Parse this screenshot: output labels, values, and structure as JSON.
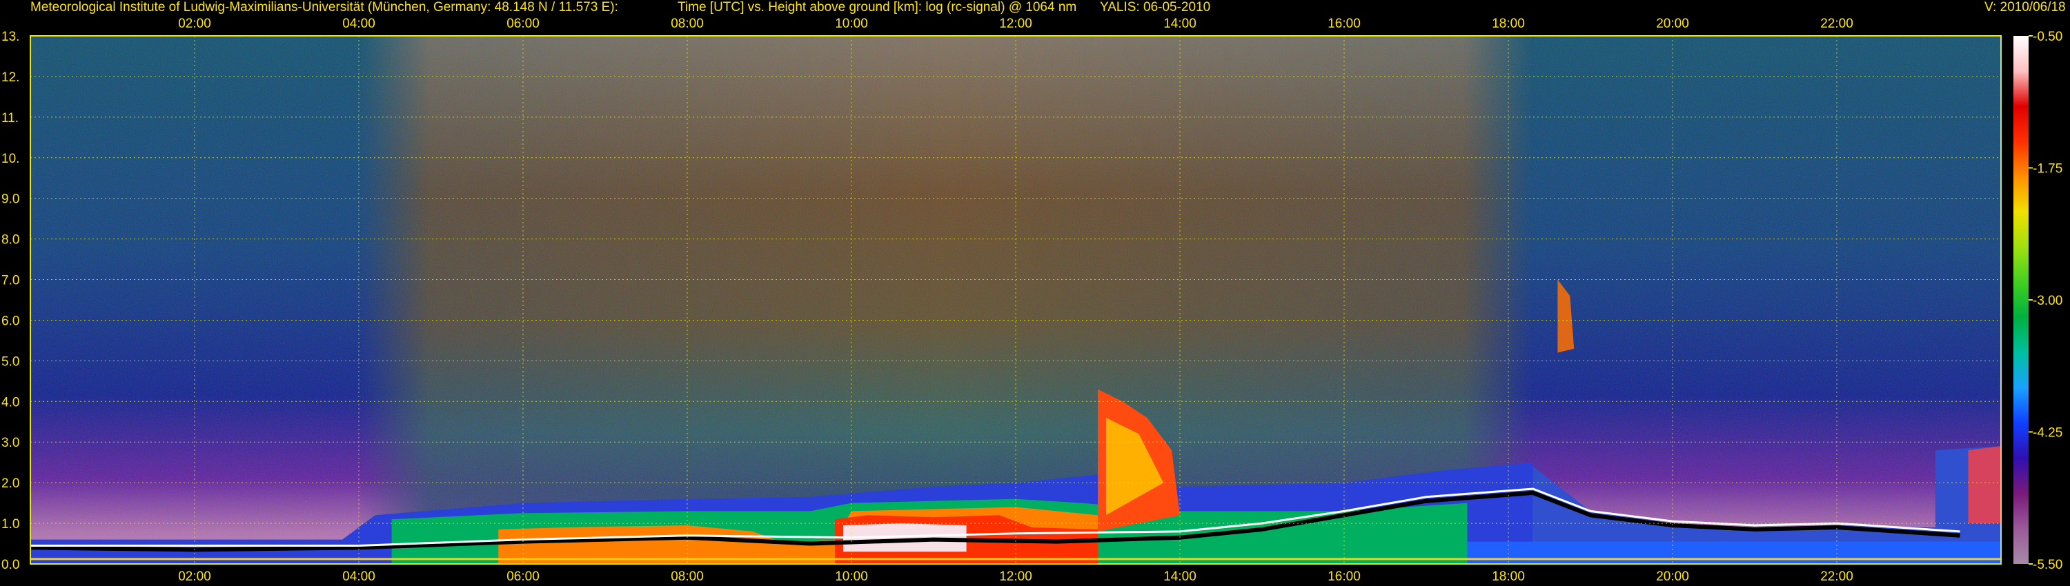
{
  "header": {
    "institute": "Meteorological Institute of Ludwig-Maximilians-Universität (München, Germany: 48.148 N / 11.573 E):",
    "title": "Time [UTC] vs. Height above ground [km]: log (rc-signal) @ 1064 nm",
    "instrument": "YALIS: 06-05-2010",
    "version": "V: 2010/06/18"
  },
  "chart_data": {
    "type": "heatmap",
    "title": "Time [UTC] vs. Height above ground [km]: log (rc-signal) @ 1064 nm",
    "x_ticks": [
      "02:00",
      "04:00",
      "06:00",
      "08:00",
      "10:00",
      "12:00",
      "14:00",
      "16:00",
      "18:00",
      "20:00",
      "22:00"
    ],
    "x_range_hours": [
      0,
      24
    ],
    "x_tick_hours": [
      2,
      4,
      6,
      8,
      10,
      12,
      14,
      16,
      18,
      20,
      22
    ],
    "y_ticks": [
      "0.0",
      "1.0",
      "2.0",
      "3.0",
      "4.0",
      "5.0",
      "6.0",
      "7.0",
      "8.0",
      "9.0",
      "10.",
      "11.",
      "12.",
      "13."
    ],
    "y_range_km": [
      0,
      13
    ],
    "grid": true,
    "colorbar": {
      "ticks": [
        "-0.50",
        "-1.75",
        "-3.00",
        "-4.25",
        "-5.50"
      ],
      "range": [
        -5.5,
        -0.5
      ],
      "colors": [
        "#a88aa8",
        "#9a5a9a",
        "#7a1a7a",
        "#3010b0",
        "#1040ff",
        "#1aa0ff",
        "#00c0a0",
        "#00b040",
        "#40d020",
        "#a0e010",
        "#f0e000",
        "#ff9000",
        "#ff3000",
        "#e00000",
        "#ffc0c0",
        "#ffffff"
      ]
    }
  }
}
